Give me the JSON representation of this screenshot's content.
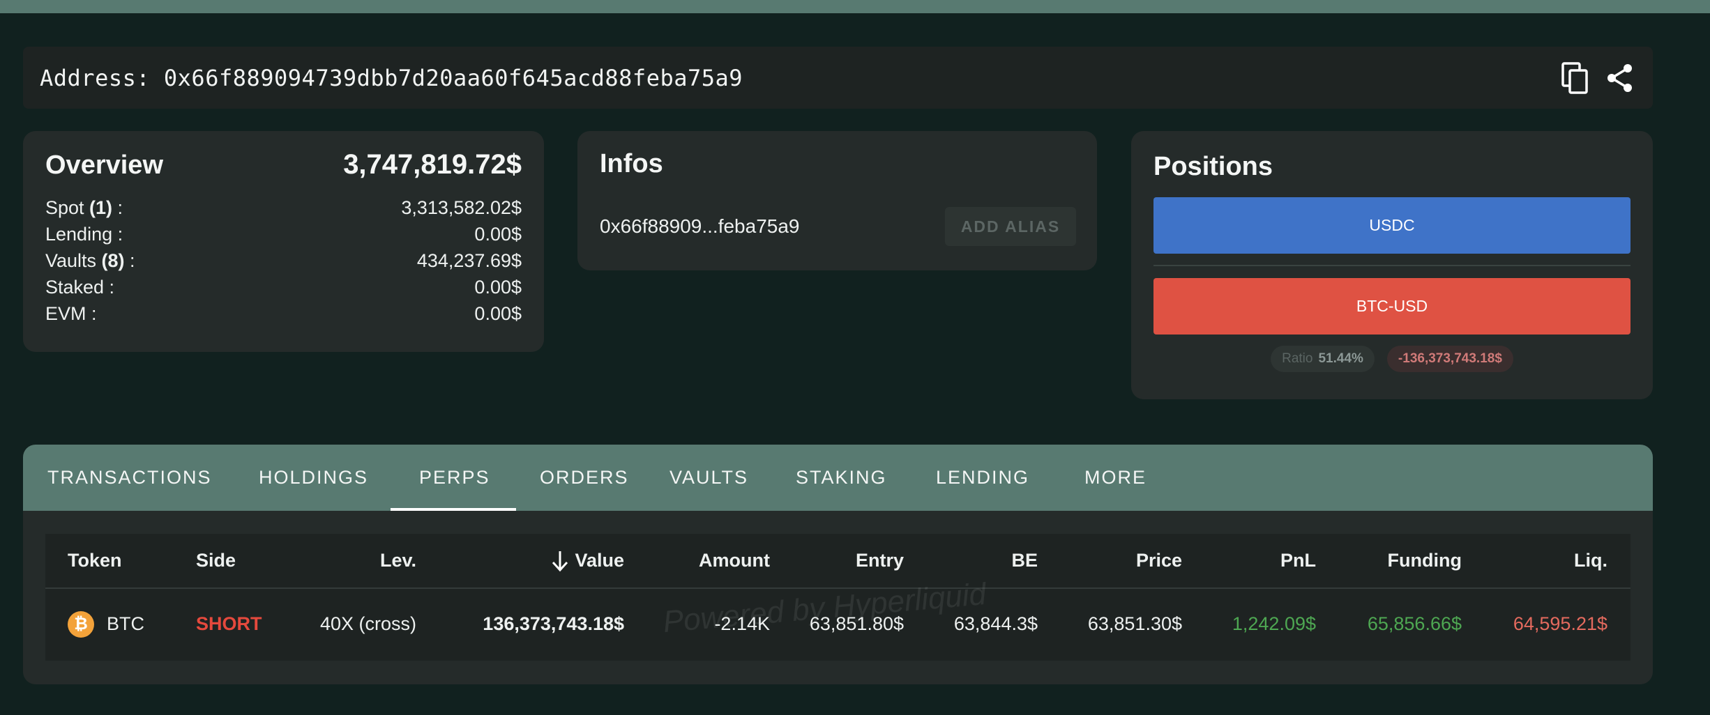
{
  "address": {
    "text": "Address: 0x66f889094739dbb7d20aa60f645acd88feba75a9",
    "copy_icon": "copy-icon",
    "share_icon": "share-icon"
  },
  "overview": {
    "title": "Overview",
    "total": "3,747,819.72$",
    "rows": [
      {
        "label": "Spot ",
        "count": "(1)",
        "suffix": " :",
        "value": "3,313,582.02$"
      },
      {
        "label": "Lending :",
        "count": "",
        "suffix": "",
        "value": "0.00$"
      },
      {
        "label": "Vaults ",
        "count": "(8)",
        "suffix": " :",
        "value": "434,237.69$"
      },
      {
        "label": "Staked :",
        "count": "",
        "suffix": "",
        "value": "0.00$"
      },
      {
        "label": "EVM :",
        "count": "",
        "suffix": "",
        "value": "0.00$"
      }
    ]
  },
  "infos": {
    "title": "Infos",
    "short_address": "0x66f88909...feba75a9",
    "add_alias_label": "ADD ALIAS"
  },
  "positions": {
    "title": "Positions",
    "usdc_label": "USDC",
    "btc_label": "BTC-USD",
    "ratio_label": "Ratio",
    "ratio_value": "51.44%",
    "net_value": "-136,373,743.18$",
    "colors": {
      "usdc": "#3f73c8",
      "btc": "#df5243"
    }
  },
  "tabs": [
    "TRANSACTIONS",
    "HOLDINGS",
    "PERPS",
    "ORDERS",
    "VAULTS",
    "STAKING",
    "LENDING",
    "MORE"
  ],
  "active_tab": "PERPS",
  "table": {
    "headers": [
      "Token",
      "Side",
      "Lev.",
      "Value",
      "Amount",
      "Entry",
      "BE",
      "Price",
      "PnL",
      "Funding",
      "Liq."
    ],
    "sort_icon": "arrow-down-icon",
    "rows": [
      {
        "token": "BTC",
        "token_icon": "bitcoin-icon",
        "side": "SHORT",
        "lev": "40X (cross)",
        "value": "136,373,743.18$",
        "amount": "-2.14K",
        "entry": "63,851.80$",
        "be": "63,844.3$",
        "price": "63,851.30$",
        "pnl": "1,242.09$",
        "funding": "65,856.66$",
        "liq": "64,595.21$"
      }
    ]
  },
  "watermark": "Powered by Hyperliquid"
}
